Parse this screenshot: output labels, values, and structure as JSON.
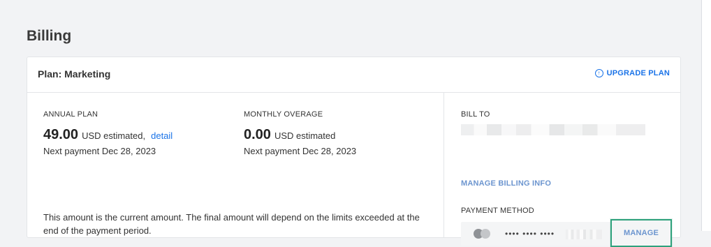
{
  "page": {
    "title": "Billing"
  },
  "plan": {
    "name": "Plan: Marketing",
    "upgrade_label": "UPGRADE PLAN"
  },
  "annual": {
    "label": "ANNUAL PLAN",
    "amount": "49.00",
    "currency_text": "USD estimated,",
    "detail_link": "detail",
    "next_payment": "Next payment Dec 28, 2023"
  },
  "overage": {
    "label": "MONTHLY OVERAGE",
    "amount": "0.00",
    "currency_text": "USD estimated",
    "next_payment": "Next payment Dec 28, 2023"
  },
  "note": "This amount is the current amount. The final amount will depend on the limits exceeded at the end of the payment period.",
  "bill_to": {
    "label": "BILL TO",
    "manage_link": "MANAGE BILLING INFO"
  },
  "payment_method": {
    "label": "PAYMENT METHOD",
    "masked_number": "•••• •••• ••••",
    "manage_label": "MANAGE"
  },
  "colors": {
    "accent": "#1a73e8",
    "link_muted": "#6c95cf",
    "highlight_border": "#2ea17c"
  }
}
